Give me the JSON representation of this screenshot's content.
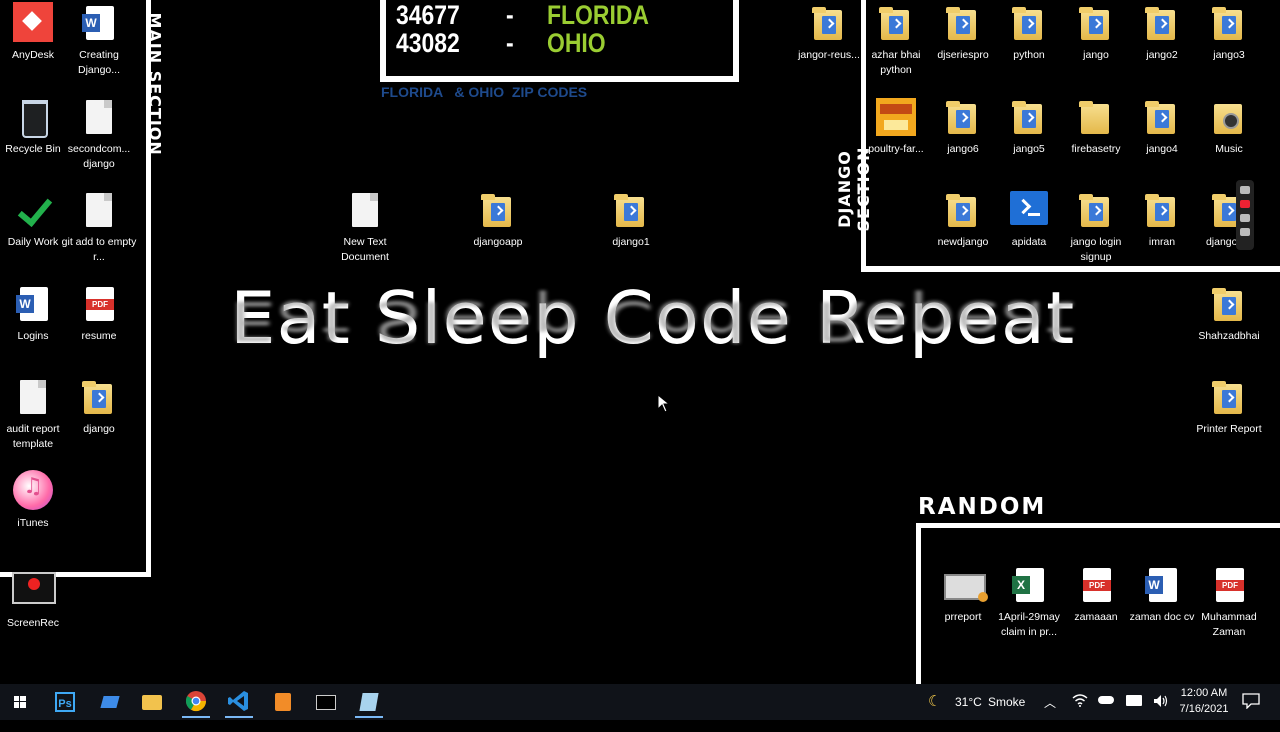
{
  "zip_codes": {
    "rows": [
      {
        "code": "34677",
        "dash": "-",
        "state": "FLORIDA"
      },
      {
        "code": "43082",
        "dash": "-",
        "state": "OHIO"
      }
    ],
    "caption": "FLORIDA   & OHIO  ZIP CODES",
    "state_color": "#9acd32",
    "caption_color": "#1e4a8c"
  },
  "sections": {
    "main": "MAIN SECTION",
    "django": "DJANGO SECTION",
    "random": "RANDOM"
  },
  "tagline": "Eat Sleep Code Repeat",
  "left_icons": [
    {
      "label": "AnyDesk",
      "icon": "anydesk-icon"
    },
    {
      "label": "Creating Django...",
      "icon": "word-doc-icon"
    },
    {
      "label": "Recycle Bin",
      "icon": "recycle-bin-icon"
    },
    {
      "label": "secondcom... django",
      "icon": "text-file-icon"
    },
    {
      "label": "Daily Work",
      "icon": "checkmark-icon"
    },
    {
      "label": "git add to empty r...",
      "icon": "text-file-icon"
    },
    {
      "label": "Logins",
      "icon": "word-doc-icon"
    },
    {
      "label": "resume",
      "icon": "pdf-icon"
    },
    {
      "label": "audit report template",
      "icon": "text-file-icon"
    },
    {
      "label": "django",
      "icon": "folder-icon"
    },
    {
      "label": "iTunes",
      "icon": "itunes-icon"
    },
    {
      "label": "ScreenRec",
      "icon": "screenrec-icon"
    }
  ],
  "center_icons": [
    {
      "label": "New Text Document",
      "icon": "text-file-icon"
    },
    {
      "label": "djangoapp",
      "icon": "folder-icon"
    },
    {
      "label": "django1",
      "icon": "folder-icon"
    }
  ],
  "django_icons": [
    {
      "label": "jangor-reus...",
      "icon": "powershell-icon"
    },
    {
      "label": "azhar bhai python",
      "icon": "folder-icon"
    },
    {
      "label": "djseriespro",
      "icon": "folder-icon"
    },
    {
      "label": "python",
      "icon": "folder-icon"
    },
    {
      "label": "jango",
      "icon": "folder-icon"
    },
    {
      "label": "jango2",
      "icon": "folder-icon"
    },
    {
      "label": "jango3",
      "icon": "folder-icon"
    },
    {
      "label": "poultry-far...",
      "icon": "poultry-icon"
    },
    {
      "label": "jango6",
      "icon": "folder-icon"
    },
    {
      "label": "jango5",
      "icon": "folder-icon"
    },
    {
      "label": "firebasetry",
      "icon": "folder-icon"
    },
    {
      "label": "jango4",
      "icon": "folder-icon"
    },
    {
      "label": "Music",
      "icon": "music-folder-icon"
    },
    {
      "label": "newdjango",
      "icon": "folder-icon"
    },
    {
      "label": "apidata",
      "icon": "powershell-icon"
    },
    {
      "label": "jango login signup",
      "icon": "folder-icon"
    },
    {
      "label": "imran",
      "icon": "folder-icon"
    },
    {
      "label": "django3...",
      "icon": "folder-icon"
    }
  ],
  "right_icons": [
    {
      "label": "Shahzadbhai",
      "icon": "folder-icon"
    },
    {
      "label": "Printer Report",
      "icon": "folder-icon"
    }
  ],
  "random_icons": [
    {
      "label": "prreport",
      "icon": "video-file-icon"
    },
    {
      "label": "1April-29may claim in pr...",
      "icon": "excel-icon"
    },
    {
      "label": "zamaaan",
      "icon": "pdf-icon"
    },
    {
      "label": "zaman doc cv",
      "icon": "word-doc-icon"
    },
    {
      "label": "Muhammad Zaman",
      "icon": "pdf-icon"
    }
  ],
  "taskbar": {
    "apps": [
      "windows-start-icon",
      "photoshop-icon",
      "app-icon",
      "file-explorer-icon",
      "chrome-icon",
      "vscode-icon",
      "sublime-icon",
      "terminal-icon",
      "notepad-icon"
    ],
    "weather_temp": "31°C",
    "weather_text": "Smoke",
    "time": "12:00 AM",
    "date": "7/16/2021"
  }
}
